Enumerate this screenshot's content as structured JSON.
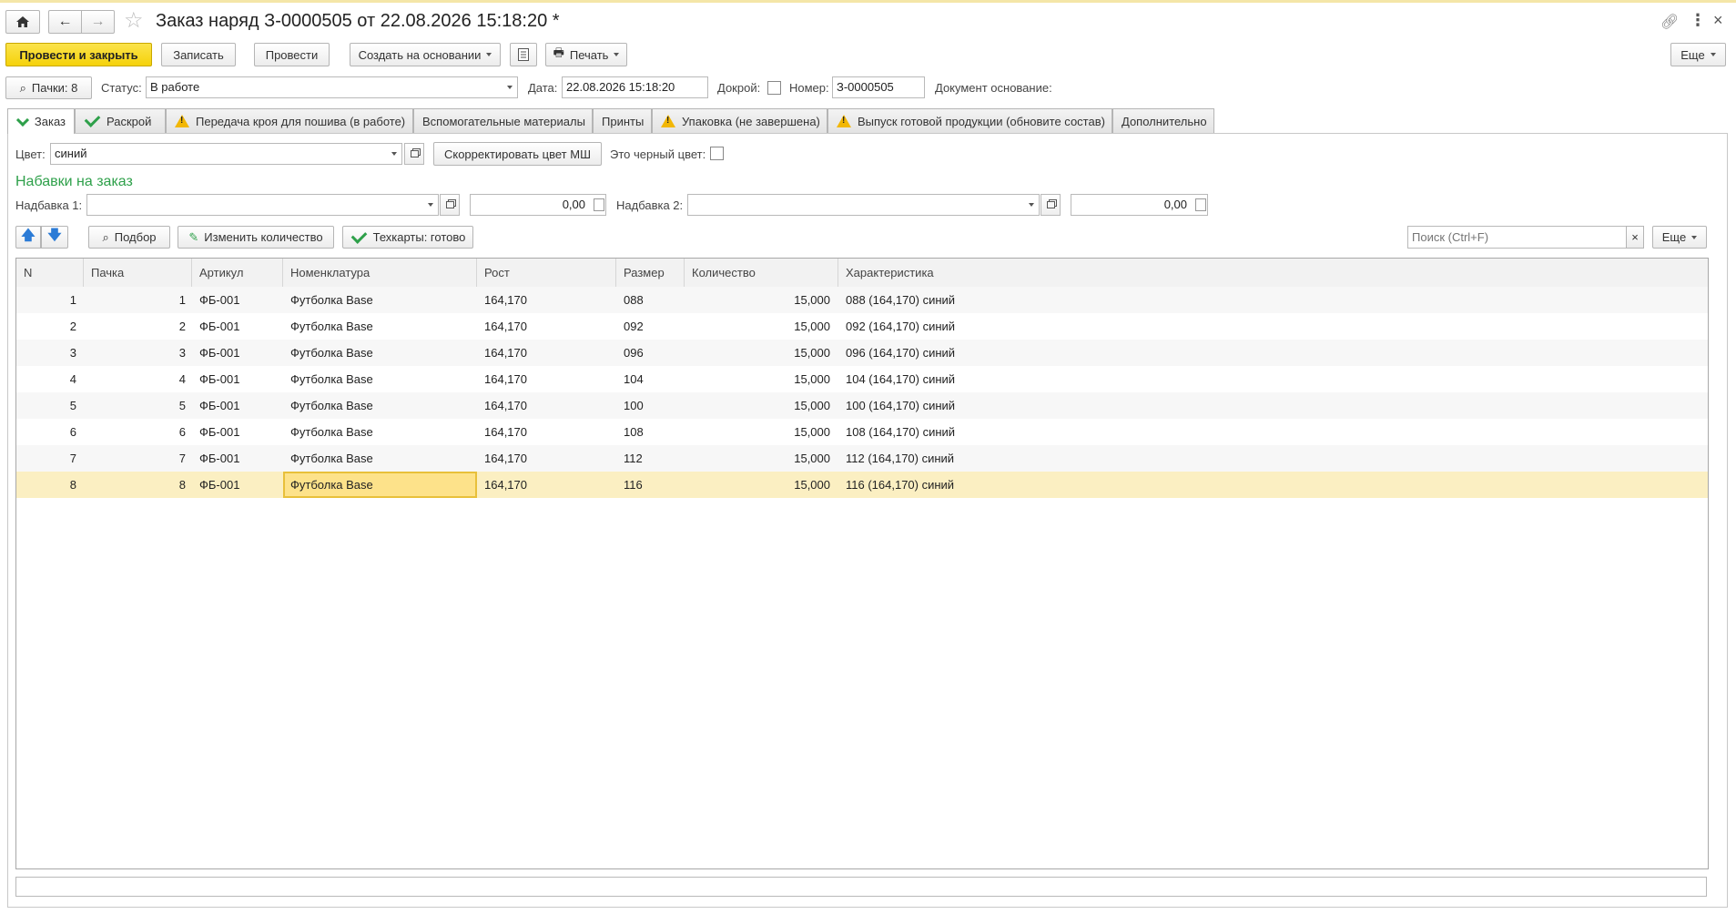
{
  "colors": {
    "primary": "#f5d20a",
    "green_check": "#2ea04a",
    "warning": "#f2b705",
    "selected_row": "#fbefc2",
    "focus_cell": "#fde28a",
    "section_title": "#2ea04a"
  },
  "window": {
    "title": "Заказ наряд З-0000505 от 22.08.2026 15:18:20 *"
  },
  "toolbar": {
    "post_close": "Провести и закрыть",
    "save": "Записать",
    "post": "Провести",
    "create_based": "Создать на основании",
    "print": "Печать",
    "more": "Еще"
  },
  "header": {
    "packs_btn": "Пачки: 8",
    "status_label": "Статус:",
    "status_value": "В работе",
    "date_label": "Дата:",
    "date_value": "22.08.2026 15:18:20",
    "dokroi_label": "Докрой:",
    "number_label": "Номер:",
    "number_value": "З-0000505",
    "base_doc_label": "Документ основание:"
  },
  "tabs": [
    {
      "label": "Заказ",
      "icon": "check-icon",
      "active": true
    },
    {
      "label": "Раскрой",
      "icon": "check-icon"
    },
    {
      "label": "Передача кроя для пошива (в работе)",
      "icon": "warning-icon"
    },
    {
      "label": "Вспомогательные материалы",
      "icon": ""
    },
    {
      "label": "Принты",
      "icon": ""
    },
    {
      "label": "Упаковка (не завершена)",
      "icon": "warning-icon"
    },
    {
      "label": "Выпуск готовой продукции (обновите состав)",
      "icon": "warning-icon"
    },
    {
      "label": "Дополнительно",
      "icon": ""
    }
  ],
  "order": {
    "color_label": "Цвет:",
    "color_value": "синий",
    "correct_color_btn": "Скорректировать цвет МШ",
    "black_label": "Это черный цвет:",
    "markups_title": "Набавки на заказ",
    "markup1_label": "Надбавка 1:",
    "markup1_value": "",
    "markup1_amount": "0,00",
    "markup2_label": "Надбавка 2:",
    "markup2_value": "",
    "markup2_amount": "0,00"
  },
  "table_toolbar": {
    "pick": "Подбор",
    "change_qty": "Изменить количество",
    "techcards": "Техкарты: готово",
    "search_placeholder": "Поиск (Ctrl+F)",
    "search_clear": "×",
    "more": "Еще"
  },
  "table": {
    "columns": [
      "N",
      "Пачка",
      "Артикул",
      "Номенклатура",
      "Рост",
      "Размер",
      "Количество",
      "Характеристика"
    ],
    "rows": [
      {
        "n": "1",
        "pack": "1",
        "article": "ФБ-001",
        "item": "Футболка Base",
        "height": "164,170",
        "size": "088",
        "qty": "15,000",
        "char": "088  (164,170) синий"
      },
      {
        "n": "2",
        "pack": "2",
        "article": "ФБ-001",
        "item": "Футболка Base",
        "height": "164,170",
        "size": "092",
        "qty": "15,000",
        "char": "092  (164,170) синий"
      },
      {
        "n": "3",
        "pack": "3",
        "article": "ФБ-001",
        "item": "Футболка Base",
        "height": "164,170",
        "size": "096",
        "qty": "15,000",
        "char": "096  (164,170) синий"
      },
      {
        "n": "4",
        "pack": "4",
        "article": "ФБ-001",
        "item": "Футболка Base",
        "height": "164,170",
        "size": "104",
        "qty": "15,000",
        "char": "104  (164,170) синий"
      },
      {
        "n": "5",
        "pack": "5",
        "article": "ФБ-001",
        "item": "Футболка Base",
        "height": "164,170",
        "size": "100",
        "qty": "15,000",
        "char": "100  (164,170) синий"
      },
      {
        "n": "6",
        "pack": "6",
        "article": "ФБ-001",
        "item": "Футболка Base",
        "height": "164,170",
        "size": "108",
        "qty": "15,000",
        "char": "108  (164,170) синий"
      },
      {
        "n": "7",
        "pack": "7",
        "article": "ФБ-001",
        "item": "Футболка Base",
        "height": "164,170",
        "size": "112",
        "qty": "15,000",
        "char": "112  (164,170) синий"
      },
      {
        "n": "8",
        "pack": "8",
        "article": "ФБ-001",
        "item": "Футболка Base",
        "height": "164,170",
        "size": "116",
        "qty": "15,000",
        "char": "116  (164,170) синий",
        "selected": true
      }
    ]
  }
}
